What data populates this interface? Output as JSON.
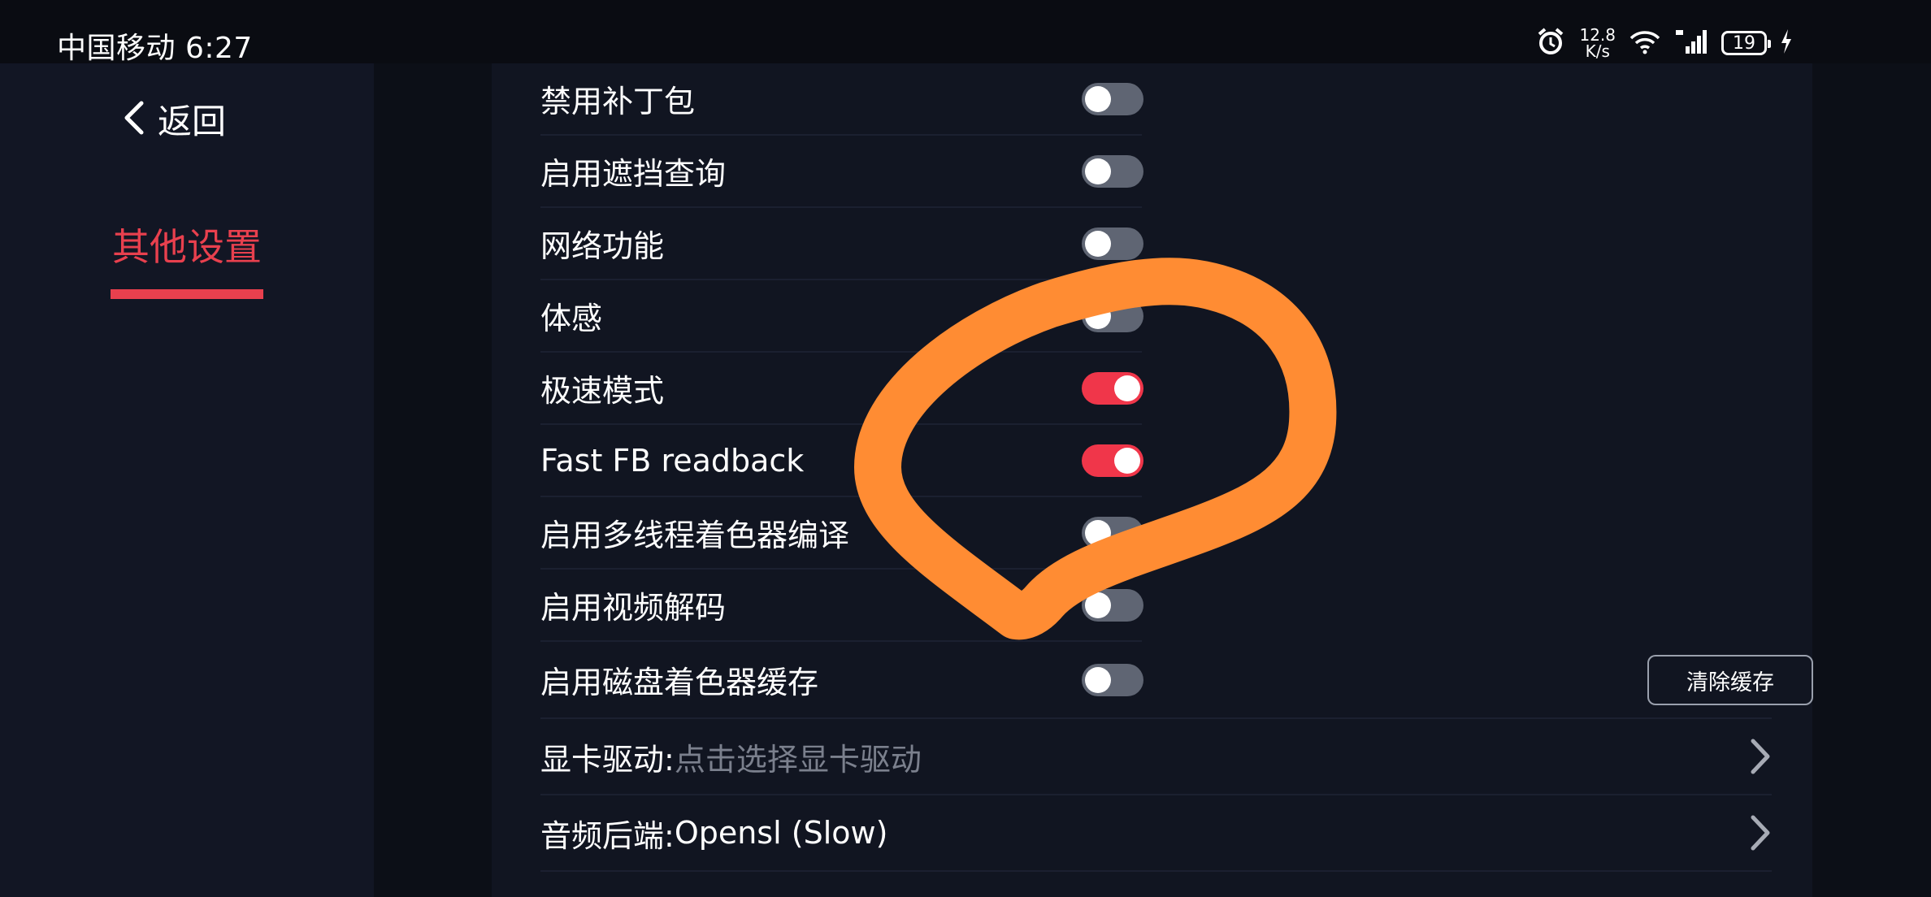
{
  "status_bar": {
    "carrier_time": "中国移动 6:27",
    "speed_value": "12.8",
    "speed_unit": "K/s",
    "battery": "19"
  },
  "sidebar": {
    "back_label": "返回",
    "tab_label": "其他设置",
    "accent_color": "#e8404e"
  },
  "settings": [
    {
      "label": "禁用补丁包",
      "enabled": false
    },
    {
      "label": "启用遮挡查询",
      "enabled": false
    },
    {
      "label": "网络功能",
      "enabled": false
    },
    {
      "label": "体感",
      "enabled": false
    },
    {
      "label": "极速模式",
      "enabled": true
    },
    {
      "label": "Fast FB readback",
      "enabled": true
    },
    {
      "label": "启用多线程着色器编译",
      "enabled": false
    },
    {
      "label": "启用视频解码",
      "enabled": false
    },
    {
      "label": "启用磁盘着色器缓存",
      "enabled": false
    }
  ],
  "clear_cache_label": "清除缓存",
  "gpu_driver": {
    "label": "显卡驱动:",
    "hint": "点击选择显卡驱动"
  },
  "audio_backend": {
    "label": "音频后端:",
    "value": "Opensl (Slow)"
  },
  "annotation": {
    "shape": "hand-drawn loop",
    "color": "#ff8c33"
  },
  "toggle_colors": {
    "on": "#f0364a",
    "off": "#5f6573"
  }
}
